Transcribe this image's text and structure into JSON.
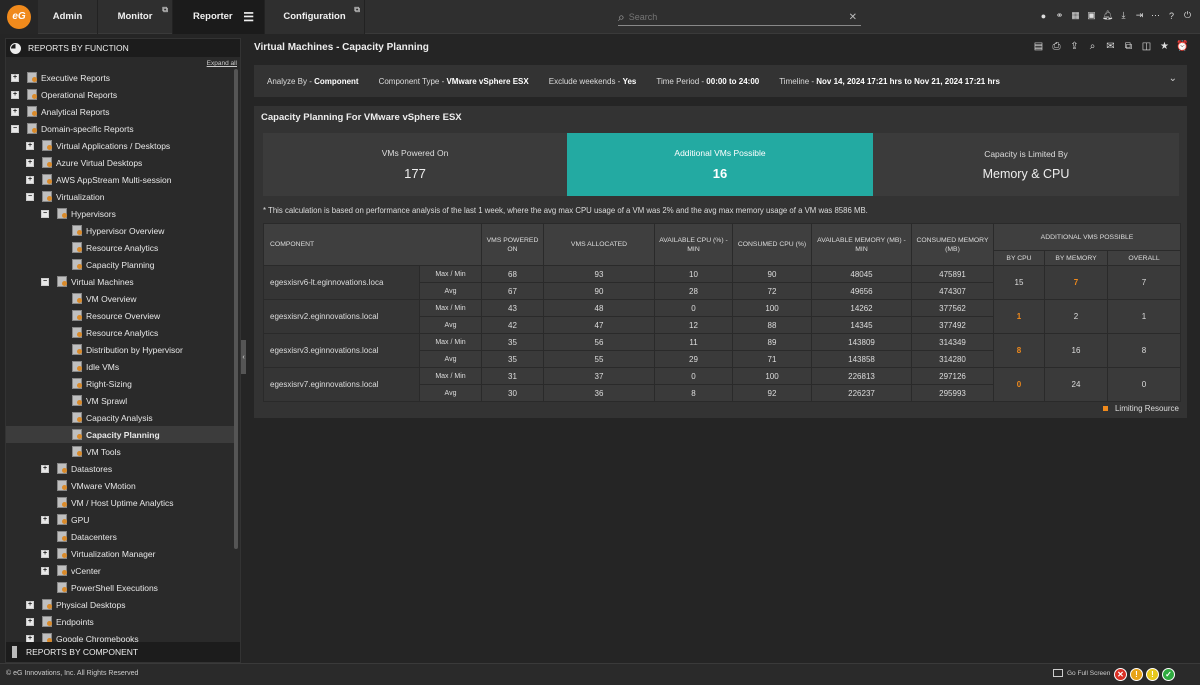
{
  "nav": {
    "logo": "eG",
    "tabs": [
      "Admin",
      "Monitor",
      "Reporter",
      "Configuration"
    ],
    "search_placeholder": "Search"
  },
  "sidebar": {
    "header": "REPORTS BY FUNCTION",
    "expand_all": "Expand all",
    "footer": "REPORTS BY COMPONENT",
    "items": [
      {
        "label": "Executive Reports"
      },
      {
        "label": "Operational Reports"
      },
      {
        "label": "Analytical Reports"
      },
      {
        "label": "Domain-specific Reports"
      },
      {
        "label": "Virtual Applications / Desktops"
      },
      {
        "label": "Azure Virtual Desktops"
      },
      {
        "label": "AWS AppStream Multi-session"
      },
      {
        "label": "Virtualization"
      },
      {
        "label": "Hypervisors"
      },
      {
        "label": "Hypervisor Overview"
      },
      {
        "label": "Resource Analytics"
      },
      {
        "label": "Capacity Planning"
      },
      {
        "label": "Virtual Machines"
      },
      {
        "label": "VM Overview"
      },
      {
        "label": "Resource Overview"
      },
      {
        "label": "Resource Analytics"
      },
      {
        "label": "Distribution by Hypervisor"
      },
      {
        "label": "Idle VMs"
      },
      {
        "label": "Right-Sizing"
      },
      {
        "label": "VM Sprawl"
      },
      {
        "label": "Capacity Analysis"
      },
      {
        "label": "Capacity Planning"
      },
      {
        "label": "VM Tools"
      },
      {
        "label": "Datastores"
      },
      {
        "label": "VMware VMotion"
      },
      {
        "label": "VM / Host Uptime Analytics"
      },
      {
        "label": "GPU"
      },
      {
        "label": "Datacenters"
      },
      {
        "label": "Virtualization Manager"
      },
      {
        "label": "vCenter"
      },
      {
        "label": "PowerShell Executions"
      },
      {
        "label": "Physical Desktops"
      },
      {
        "label": "Endpoints"
      },
      {
        "label": "Google Chromebooks"
      }
    ]
  },
  "page": {
    "title": "Virtual Machines - Capacity Planning",
    "filters": {
      "analyze_by_label": "Analyze By - ",
      "analyze_by_value": "Component",
      "component_type_label": "Component Type - ",
      "component_type_value": "VMware vSphere ESX",
      "exclude_weekends_label": "Exclude weekends - ",
      "exclude_weekends_value": "Yes",
      "time_period_label": "Time Period - ",
      "time_period_value": "00:00 to 24:00",
      "timeline_label": "Timeline - ",
      "timeline_value": "Nov 14, 2024 17:21 hrs to Nov 21, 2024 17:21 hrs"
    }
  },
  "panel": {
    "title": "Capacity Planning For VMware vSphere ESX",
    "kpis": [
      {
        "label": "VMs Powered On",
        "value": "177"
      },
      {
        "label": "Additional VMs Possible",
        "value": "16"
      },
      {
        "label": "Capacity is Limited By",
        "value": "Memory & CPU"
      }
    ],
    "note": "* This calculation is based on performance analysis of the last 1 week, where the avg max CPU usage of a VM was 2% and the avg max memory usage of a VM was 8586 MB.",
    "headers": {
      "component": "COMPONENT",
      "vms_powered_on": "VMS POWERED ON",
      "vms_allocated": "VMS ALLOCATED",
      "available_cpu": "AVAILABLE CPU (%) - MIN",
      "consumed_cpu": "CONSUMED CPU (%)",
      "available_memory": "AVAILABLE MEMORY (MB) - MIN",
      "consumed_memory": "CONSUMED MEMORY (MB)",
      "additional": "ADDITIONAL VMS POSSIBLE",
      "by_cpu": "BY CPU",
      "by_memory": "BY MEMORY",
      "overall": "OVERALL"
    },
    "rows": [
      {
        "name": "egesxisrv6-lt.eginnovations.loca",
        "maxmin": {
          "label": "Max / Min",
          "powered": "68",
          "allocated": "93",
          "avail_cpu": "10",
          "cons_cpu": "90",
          "avail_mem": "48045",
          "cons_mem": "475891"
        },
        "avg": {
          "label": "Avg",
          "powered": "67",
          "allocated": "90",
          "avail_cpu": "28",
          "cons_cpu": "72",
          "avail_mem": "49656",
          "cons_mem": "474307"
        },
        "by_cpu": "15",
        "by_memory": "7",
        "overall": "7",
        "limit": "memory"
      },
      {
        "name": "egesxisrv2.eginnovations.local",
        "maxmin": {
          "label": "Max / Min",
          "powered": "43",
          "allocated": "48",
          "avail_cpu": "0",
          "cons_cpu": "100",
          "avail_mem": "14262",
          "cons_mem": "377562"
        },
        "avg": {
          "label": "Avg",
          "powered": "42",
          "allocated": "47",
          "avail_cpu": "12",
          "cons_cpu": "88",
          "avail_mem": "14345",
          "cons_mem": "377492"
        },
        "by_cpu": "1",
        "by_memory": "2",
        "overall": "1",
        "limit": "cpu"
      },
      {
        "name": "egesxisrv3.eginnovations.local",
        "maxmin": {
          "label": "Max / Min",
          "powered": "35",
          "allocated": "56",
          "avail_cpu": "11",
          "cons_cpu": "89",
          "avail_mem": "143809",
          "cons_mem": "314349"
        },
        "avg": {
          "label": "Avg",
          "powered": "35",
          "allocated": "55",
          "avail_cpu": "29",
          "cons_cpu": "71",
          "avail_mem": "143858",
          "cons_mem": "314280"
        },
        "by_cpu": "8",
        "by_memory": "16",
        "overall": "8",
        "limit": "cpu"
      },
      {
        "name": "egesxisrv7.eginnovations.local",
        "maxmin": {
          "label": "Max / Min",
          "powered": "31",
          "allocated": "37",
          "avail_cpu": "0",
          "cons_cpu": "100",
          "avail_mem": "226813",
          "cons_mem": "297126"
        },
        "avg": {
          "label": "Avg",
          "powered": "30",
          "allocated": "36",
          "avail_cpu": "8",
          "cons_cpu": "92",
          "avail_mem": "226237",
          "cons_mem": "295993"
        },
        "by_cpu": "0",
        "by_memory": "24",
        "overall": "0",
        "limit": "cpu"
      }
    ],
    "legend": "Limiting Resource"
  },
  "footer": {
    "copyright": "© eG Innovations, Inc. All Rights Reserved",
    "fullscreen": "Go Full Screen"
  },
  "colors": {
    "accent": "#23aaa2",
    "limit": "#f08a1c",
    "brand": "#f08a1c"
  }
}
